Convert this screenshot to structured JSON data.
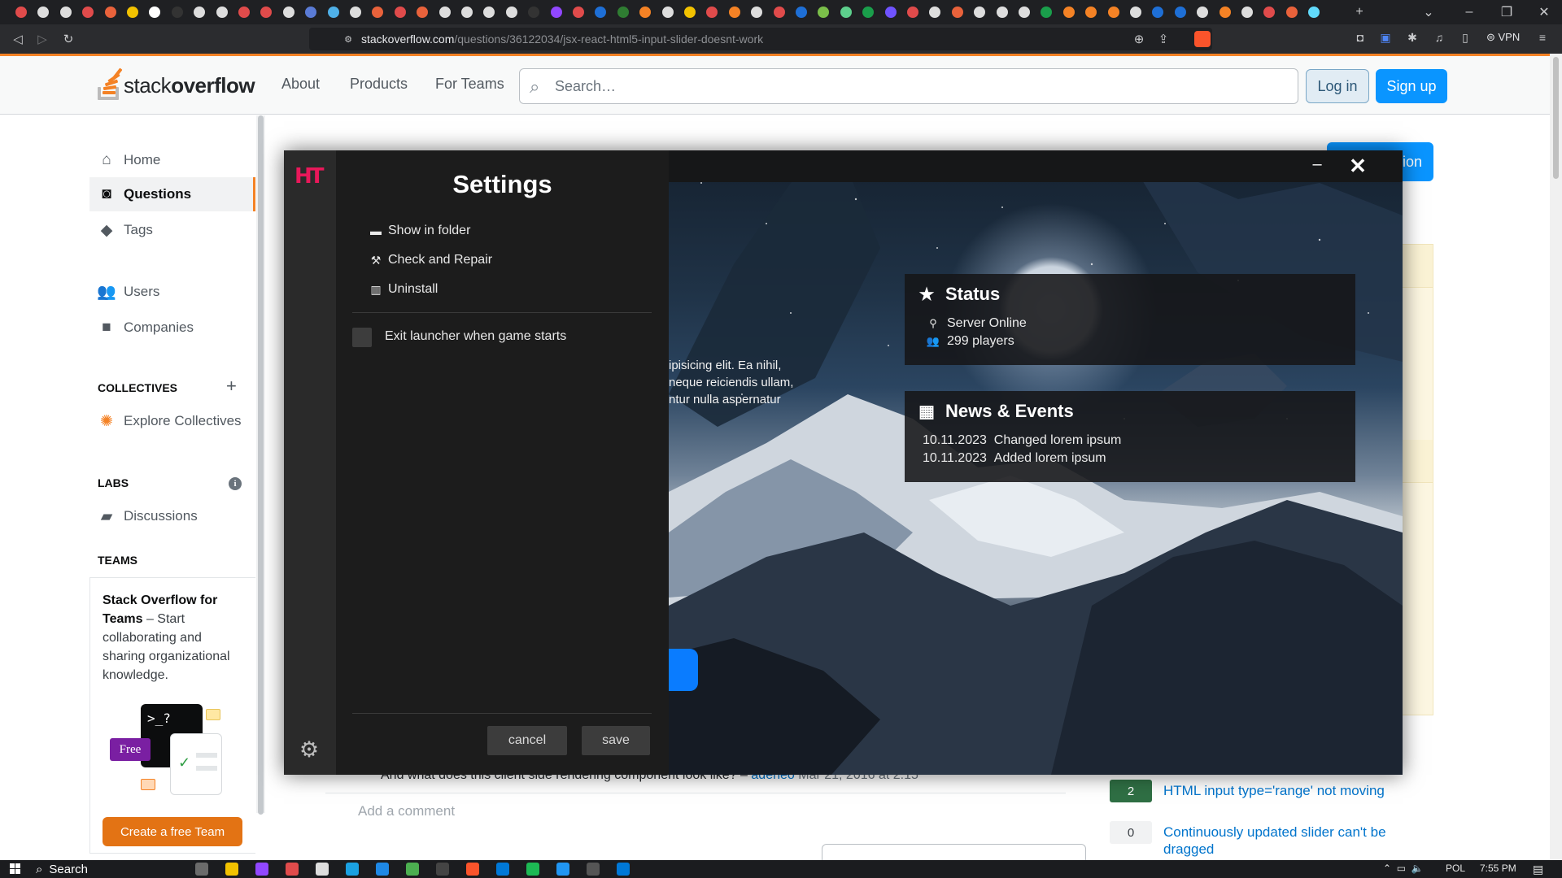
{
  "browser": {
    "url_host": "stackoverflow.com",
    "url_path": "/questions/36122034/jsx-react-html5-input-slider-doesnt-work",
    "vpn_label": "VPN",
    "tab_icon_colors": [
      "#e04b4b",
      "#dddddd",
      "#dddddd",
      "#e04b4b",
      "#e9623b",
      "#f2c200",
      "#ffffff",
      "#333333",
      "#dddddd",
      "#dddddd",
      "#e04b4b",
      "#e04b4b",
      "#dddddd",
      "#5a7bd6",
      "#4fb0e8",
      "#dddddd",
      "#e9623b",
      "#e04b4b",
      "#e9623b",
      "#dddddd",
      "#dddddd",
      "#dddddd",
      "#dddddd",
      "#333333",
      "#9147ff",
      "#e04b4b",
      "#1e6fd6",
      "#2f7d32",
      "#f48225",
      "#dddddd",
      "#f2c200",
      "#e04b4b",
      "#f48225",
      "#dddddd",
      "#e04b4b",
      "#1e6fd6",
      "#7bbf4a",
      "#5dcf8c",
      "#1a9e4b",
      "#6f53ff",
      "#e04b4b",
      "#dddddd",
      "#e9623b",
      "#dddddd",
      "#dddddd",
      "#dddddd",
      "#1a9e4b",
      "#f48225",
      "#f48225",
      "#f48225",
      "#dddddd",
      "#1e6fd6",
      "#1e6fd6",
      "#dddddd",
      "#f48225",
      "#dddddd",
      "#e04b4b",
      "#e9623b",
      "#61dafb"
    ]
  },
  "so": {
    "logo_text_light": "stack",
    "logo_text_bold": "overflow",
    "nav": {
      "about": "About",
      "products": "Products",
      "for_teams": "For Teams"
    },
    "search_placeholder": "Search…",
    "login": "Log in",
    "signup": "Sign up",
    "ask_question_partial": "stion",
    "sidebar": {
      "home": "Home",
      "questions": "Questions",
      "tags": "Tags",
      "users": "Users",
      "companies": "Companies",
      "collectives_head": "COLLECTIVES",
      "explore_collectives": "Explore Collectives",
      "labs_head": "LABS",
      "discussions": "Discussions",
      "teams_head": "TEAMS",
      "teams_title": "Stack Overflow for Teams",
      "teams_body": " – Start collaborating and sharing organizational knowledge.",
      "teams_free_badge": "Free",
      "create_team": "Create a free Team"
    },
    "comment_text": "And what does this client side rendering component look like? –",
    "comment_user": "adeneo",
    "comment_date": "Mar 21, 2016 at 2:15",
    "add_comment": "Add a comment",
    "related": [
      {
        "count": "2",
        "title": "HTML input type='range' not moving",
        "answered": true
      },
      {
        "count": "0",
        "title": "Continuously updated slider can't be dragged",
        "answered": false
      }
    ]
  },
  "launcher": {
    "logo": "HT",
    "settings_title": "Settings",
    "menu": [
      {
        "icon": "folder-icon",
        "label": "Show in folder"
      },
      {
        "icon": "wrench-icon",
        "label": "Check and Repair"
      },
      {
        "icon": "trash-icon",
        "label": "Uninstall"
      }
    ],
    "exit_checkbox_label": "Exit launcher when game starts",
    "exit_checkbox_checked": false,
    "cancel": "cancel",
    "save": "save",
    "hero_text_lines": [
      "ipisicing elit. Ea nihil,",
      "neque reiciendis ullam,",
      "ntur nulla aspernatur"
    ],
    "status": {
      "title": "Status",
      "server": "Server Online",
      "players": "299 players"
    },
    "news": {
      "title": "News & Events",
      "items": [
        {
          "date": "10.11.2023",
          "text": "Changed lorem ipsum"
        },
        {
          "date": "10.11.2023",
          "text": "Added lorem ipsum"
        }
      ]
    }
  },
  "taskbar": {
    "search": "Search",
    "language": "POL",
    "time": "7:55 PM",
    "app_colors": [
      "#6b6b6b",
      "#f2c200",
      "#9147ff",
      "#e04b4b",
      "#dddddd",
      "#1ba1e2",
      "#1e88e5",
      "#4caf50",
      "#444444",
      "#fb542b",
      "#0078d7",
      "#1db954",
      "#2196f3",
      "#555555",
      "#0078d7"
    ]
  }
}
